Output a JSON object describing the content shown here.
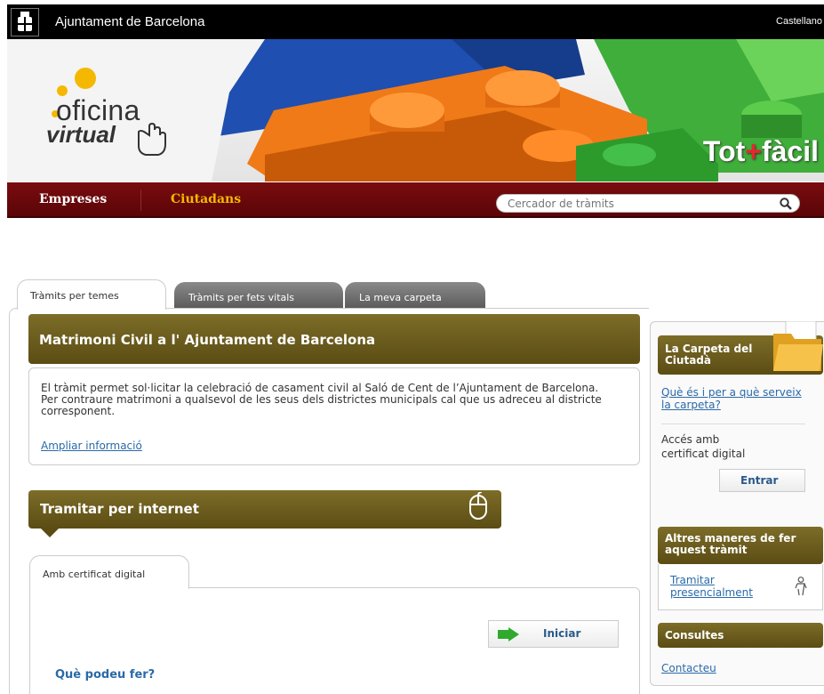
{
  "header": {
    "site_name": "Ajuntament de Barcelona",
    "language_link": "Castellano"
  },
  "banner": {
    "logo_word1": "oficina",
    "logo_word2": "virtual",
    "tagline_part1": "Tot",
    "tagline_plus": "+",
    "tagline_part2": "fàcil"
  },
  "nav": {
    "items": [
      {
        "label": "Empreses"
      },
      {
        "label": "Ciutadans"
      }
    ],
    "search_placeholder": "Cercador de tràmits"
  },
  "tabs": [
    {
      "label": "Tràmits per temes",
      "active": true
    },
    {
      "label": "Tràmits per fets vitals",
      "active": false
    },
    {
      "label": "La meva carpeta",
      "active": false
    }
  ],
  "main": {
    "title": "Matrimoni Civil a l' Ajuntament de Barcelona",
    "description_line1": "El tràmit permet sol·licitar la celebració de casament civil al Saló de Cent de l’Ajuntament de Barcelona.",
    "description_line2": "Per contraure matrimoni a qualsevol de les seus dels districtes municipals cal que us adreceu al districte corresponent.",
    "more_info_link": "Ampliar informació",
    "tramitar_title": "Tramitar per internet",
    "subtab_label": "Amb certificat digital",
    "start_button": "Iniciar",
    "what_can_you_do": "Què podeu fer?"
  },
  "sidebar": {
    "carpeta_title": "La Carpeta del Ciutadà",
    "carpeta_link": "Què és i per a què serveix la carpeta?",
    "access_text": "Accés amb certificat digital",
    "enter_button": "Entrar",
    "altres_title": "Altres maneres de fer aquest tràmit",
    "presencial_link": "Tramitar presencialment",
    "consultes_title": "Consultes",
    "contact_link": "Contacteu"
  },
  "colors": {
    "nav_bg": "#6a0809",
    "nav_active": "#f5b800",
    "olive_header": "#6e5e1e",
    "link": "#2a6aa8",
    "tagline_plus": "#e8262e"
  },
  "icons": [
    "barcelona-crest-icon",
    "search-icon",
    "hand-cursor-icon",
    "mouse-icon",
    "green-arrow-icon",
    "folder-icon",
    "person-icon"
  ]
}
